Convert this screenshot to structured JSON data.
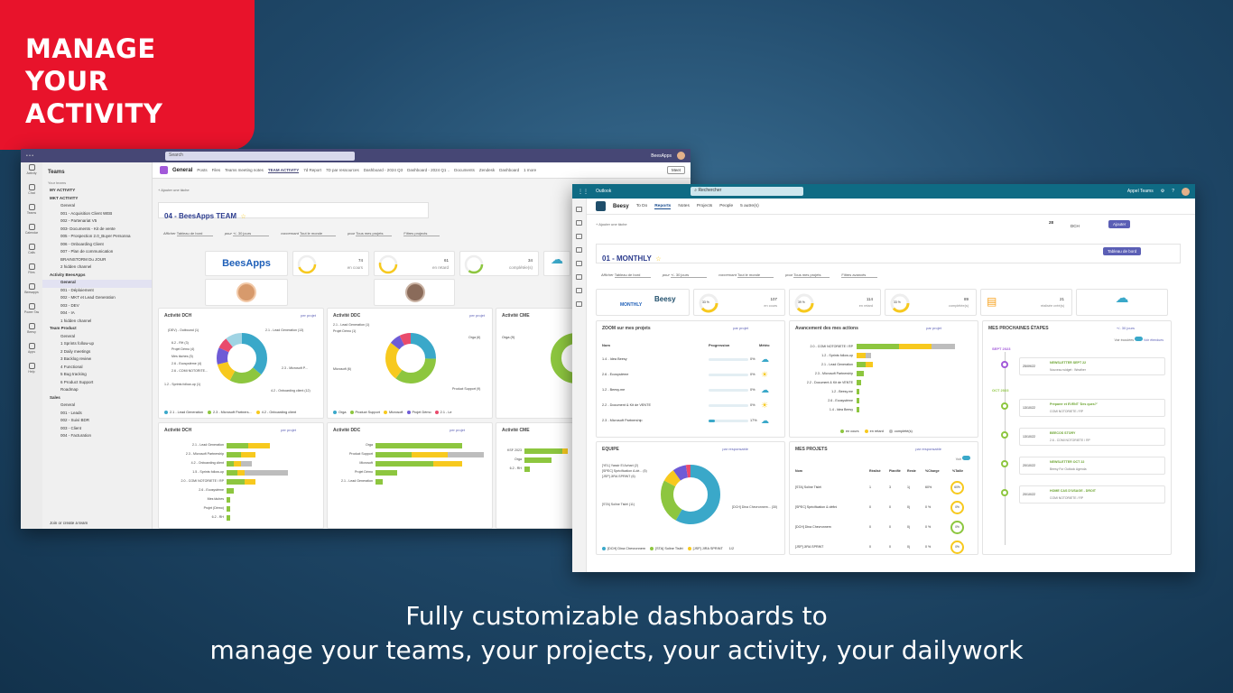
{
  "hero": {
    "title_lines": [
      "MANAGE",
      "YOUR",
      "ACTIVITY"
    ],
    "caption_lines": [
      "Fully customizable dashboards to",
      "manage your teams, your projects, your activity, your dailywork"
    ]
  },
  "colors": {
    "red": "#e8132b",
    "teams": "#464775",
    "outlook": "#0f6b84",
    "teal": "#3aa8c9",
    "green": "#8dc63f",
    "yellow": "#f7c91e",
    "gray": "#bdbdbd",
    "purple": "#6e5bd6"
  },
  "teams": {
    "search": "Search",
    "user": "BeesApps",
    "rail": [
      "Activity",
      "Chat",
      "Teams",
      "Calendar",
      "Calls",
      "Files",
      "Beesapps",
      "Power Tas",
      "Beesy",
      "Apps",
      "Help"
    ],
    "sidebar_title": "Teams",
    "your_teams": "Your teams",
    "rows": [
      {
        "t": "MY ACTIVITY",
        "k": "team"
      },
      {
        "t": "MKT ACTIVITY",
        "k": "team"
      },
      {
        "t": "General",
        "k": "row"
      },
      {
        "t": "001 - Acquisition Client WEB",
        "k": "row"
      },
      {
        "t": "002 - Partenariat V5",
        "k": "row"
      },
      {
        "t": "003- Documents - Kit de vente",
        "k": "row"
      },
      {
        "t": "005 - Prospection 2.0_Buyer Personna",
        "k": "row"
      },
      {
        "t": "006 - Onboarding Client",
        "k": "row"
      },
      {
        "t": "007 - Plan de communication",
        "k": "row"
      },
      {
        "t": "BRAINSTORM Du JOUR",
        "k": "row"
      },
      {
        "t": "2 hidden channel",
        "k": "row"
      },
      {
        "t": "Activity BeesApps",
        "k": "team"
      },
      {
        "t": "General",
        "k": "act"
      },
      {
        "t": "001 - Déploiement",
        "k": "row"
      },
      {
        "t": "002 - MKT et Lead Generation",
        "k": "row"
      },
      {
        "t": "003 - DEV",
        "k": "row"
      },
      {
        "t": "004 - IA",
        "k": "row"
      },
      {
        "t": "1 hidden channel",
        "k": "row"
      },
      {
        "t": "Team Product",
        "k": "team"
      },
      {
        "t": "General",
        "k": "row"
      },
      {
        "t": "1 Sprints follow-up",
        "k": "row"
      },
      {
        "t": "2 Daily meetings",
        "k": "row"
      },
      {
        "t": "3 Backlog review",
        "k": "row"
      },
      {
        "t": "4 Functional",
        "k": "row"
      },
      {
        "t": "5 Bug tracking",
        "k": "row"
      },
      {
        "t": "6 Product Support",
        "k": "row"
      },
      {
        "t": "Roadmap",
        "k": "row"
      },
      {
        "t": "Sales",
        "k": "team"
      },
      {
        "t": "General",
        "k": "row"
      },
      {
        "t": "001 - Leads",
        "k": "row"
      },
      {
        "t": "002 - Suivi BDR",
        "k": "row"
      },
      {
        "t": "003 - Client",
        "k": "row"
      },
      {
        "t": "004 - Facturation",
        "k": "row"
      }
    ],
    "join": "Join or create a team",
    "channel": "General",
    "tabs": [
      "Posts",
      "Files",
      "Teams meeting notes",
      "TEAM ACTIVITY",
      "7d Report",
      "7D par ressources",
      "Dashboard - 2024 Q3",
      "Dashboard - 2024 Q1 ..",
      "Documents",
      "Zendesk",
      "Dashboard",
      "1 more"
    ],
    "meet": "Meet",
    "add_task": "+ Ajouter une tâche",
    "dash_title": "04 - BeesApps TEAM",
    "filters": [
      "Tableau de bord",
      "+/- 30 jours",
      "Tout le monde",
      "Tous mes projets",
      "Filtres projects"
    ],
    "filter_labels": [
      "Afficher",
      "pour",
      "concernant",
      "pour"
    ],
    "logo": "BeesApps",
    "gauges": [
      {
        "v": "74",
        "l": "en cours"
      },
      {
        "v": "61",
        "l": "en retard"
      },
      {
        "v": "34",
        "l": "complétée(s)"
      }
    ],
    "cards": [
      "Activité DCH",
      "Activité DDC",
      "Activité CME",
      "Activité DCH",
      "Activité DDC",
      "Activité CME"
    ],
    "per_project": "per projet",
    "donut1_labels": [
      "(DEV) - Outbound (1)",
      "6.2 - RH (3)",
      "Projet Démo (4)",
      "Mes tâches (5)",
      "2.6 - Ecosystème (4)",
      "2.6 - COMI NOTORITE...",
      "1.2 - Sprints follow-up (1)",
      "2.1 - Lead Generation (13)",
      "2.3 - Microsoft P...",
      "4.2 - Onboarding client (12)"
    ],
    "donut1_legend": [
      "2.1 - Lead Generation",
      "2.3 - Microsoft Partners...",
      "4.2 - Onboarding client"
    ],
    "donut2_labels": [
      "2.1 - Lead Generation (1)",
      "Projet Démo (1)",
      "Orga (6)",
      "Microsoft (6)",
      "Product Support (9)"
    ],
    "donut2_legend": [
      "Orga",
      "Product Support",
      "Microsoft",
      "Projet Démo",
      "2.1 - Le"
    ],
    "donut3_labels": [
      "Orga (9)"
    ],
    "bars1": [
      "2.1 - Lead Generation",
      "2.3 - Microsoft Partnership",
      "4.2 - Onboarding client",
      "1.5 - Sprints follow-up",
      "2.0 - COMI NOTORIETE / RP",
      "2.6 - Ecosystème",
      "Mes tâches",
      "Projet (Démo)",
      "6.2 - RH"
    ],
    "bars2": [
      "Orga",
      "Product Support",
      "Microsoft",
      "Projet Démo",
      "2.1 - Lead Generation"
    ],
    "bars3": [
      "KSF 2023",
      "Orga",
      "6.2 - RH"
    ]
  },
  "outlook": {
    "app": "Outlook",
    "search": "Rechercher",
    "call": "Appel Teams",
    "brand": "Beesy",
    "nav": [
      "To Do",
      "Reports",
      "Notes",
      "Projects",
      "People",
      "5 autre(s)"
    ],
    "add_task": "+ Ajouter une tâche",
    "day": "28",
    "dow": "DCH",
    "btn_add": "Ajouter",
    "dash_title": "01 - MONTHLY",
    "dash_btn": "Tableau de bord",
    "filters": [
      "Tableau de bord",
      "+/- 30 jours",
      "Tout le monde",
      "Tous mes projets",
      "Filtres avancés"
    ],
    "filter_labels": [
      "Afficher",
      "pour",
      "concernant",
      "pour"
    ],
    "monthly": "MONTHLY",
    "logo": "Beesy",
    "gauges": [
      {
        "p": "33 %",
        "v": "107",
        "l": "en cours"
      },
      {
        "p": "39 %",
        "v": "114",
        "l": "en retard"
      },
      {
        "p": "33 %",
        "v": "89",
        "l": "complétée(s)"
      },
      {
        "v": "21",
        "l": "réalisée créé(s)"
      }
    ],
    "zoom": {
      "title": "ZOOM sur mes projets",
      "filter": "par projet",
      "cols": [
        "Nom",
        "Progression",
        "Météo"
      ],
      "rows": [
        {
          "n": "1.4 - Idea Beesy",
          "p": "0%",
          "pv": 0
        },
        {
          "n": "2.6 - Ecosystème",
          "p": "0%",
          "pv": 0
        },
        {
          "n": "1.2 - Beesy.me",
          "p": "0%",
          "pv": 0
        },
        {
          "n": "2.2 - Document & Kit de VENTE",
          "p": "0%",
          "pv": 0
        },
        {
          "n": "2.3 - Microsoft Partnership",
          "p": "17%",
          "pv": 17
        }
      ]
    },
    "avancement": {
      "title": "Avancement des mes actions",
      "filter": "par projet",
      "rows": [
        "2.0 - COMI NOTORIETE / RP",
        "1.2 - Sprints follow-up",
        "2.1 - Lead Generation",
        "2.3 - Microsoft Partnership",
        "2.2 - Document & Kit de VENTE",
        "1.2 - Beesy.me",
        "2.6 - Ecosystème",
        "1.4 - Idea Beesy"
      ],
      "values": [
        [
          18,
          14,
          10
        ],
        [
          0,
          4,
          2
        ],
        [
          4,
          3,
          0
        ],
        [
          3,
          0,
          0
        ],
        [
          2,
          0,
          0
        ],
        [
          1,
          0,
          0
        ],
        [
          1,
          0,
          0
        ],
        [
          1,
          0,
          0
        ]
      ],
      "legend": [
        "en cours",
        "en retard",
        "complété(s)"
      ]
    },
    "etapes": {
      "title": "MES PROCHAINES ÉTAPES",
      "filter": "+/- 30 jours",
      "toggle": "Voir écoulées",
      "toggle2": "Voir étendues",
      "groups": [
        {
          "month": "SEPT 2023",
          "items": [
            {
              "d": "25/09/22",
              "t": "NEWSLETTER SEPT 22",
              "s": "Nouveau widget : Weather"
            }
          ]
        },
        {
          "month": "OCT 2023",
          "items": [
            {
              "d": "13/10/22",
              "t": "Préparer et EVENT 'Des ques?'",
              "s": "COMI NOTORIETE / RP"
            },
            {
              "d": "13/10/22",
              "t": "BEECOS STORY",
              "s": "2.6 - COMI NOTORIETE / RP"
            },
            {
              "d": "20/10/22",
              "t": "NEWSLETTER OCT 22",
              "s": "Beesy For Outlook Agenda"
            },
            {
              "d": "20/10/22",
              "t": "HOME CAS D'USAGE - DROIT",
              "s": "COMI NOTORIETE / RP"
            }
          ]
        }
      ]
    },
    "equipe": {
      "title": "EQUIPE",
      "filter": "par responsable",
      "labels": [
        "[YEL] Yassir El Azhari (2)",
        "[SPEC] Spécification A.dé... (5)",
        "[JSP] JIRA SPRINT (6)",
        "[STA] Soline Tisléi (11)",
        "[DCH] Dina Chevronnem... (30)"
      ],
      "legend": [
        "[DCH] Dina Chevronnem",
        "[STA] Soline Tisléi",
        "[JSP] JIRA SPRINT"
      ],
      "page": "1/2"
    },
    "projets": {
      "title": "MES PROJETS",
      "filter": "par responsable",
      "toggle": "Voir",
      "cols": [
        "Nom",
        "Réalisé",
        "Planifié",
        "Reste",
        "%Charge",
        "%Taille"
      ],
      "rows": [
        {
          "n": "[STA] Soline Tisléi",
          "a": "1",
          "b": "3",
          "c": "1j",
          "d": "60%",
          "g": "60%"
        },
        {
          "n": "[SPEC] Spécification & défini",
          "a": "0",
          "b": "0",
          "c": "0j",
          "d": "0 %",
          "g": "0%"
        },
        {
          "n": "[DCH] Dina Chevronnem",
          "a": "0",
          "b": "0",
          "c": "0j",
          "d": "0 %",
          "g": "0%"
        },
        {
          "n": "[JSP] JIRA SPRINT",
          "a": "0",
          "b": "0",
          "c": "0j",
          "d": "0 %",
          "g": "0%"
        }
      ]
    }
  }
}
